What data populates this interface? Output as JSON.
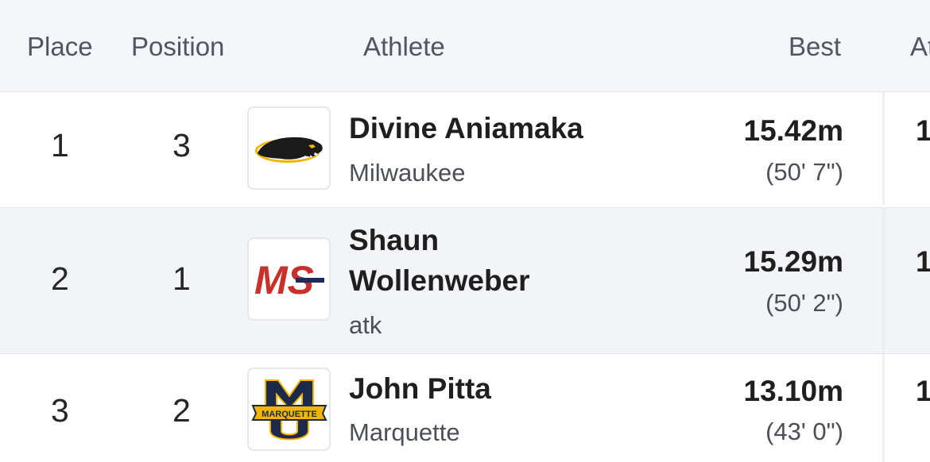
{
  "header": {
    "place": "Place",
    "position": "Position",
    "athlete": "Athlete",
    "best": "Best",
    "next_col": "At"
  },
  "rows": [
    {
      "place": "1",
      "position": "3",
      "name": "Divine Aniamaka",
      "team": "Milwaukee",
      "logo_icon": "panther-logo-icon",
      "best": "15.42m",
      "best_imperial": "(50' 7\")",
      "next_col": "1"
    },
    {
      "place": "2",
      "position": "1",
      "name_line1": "Shaun",
      "name_line2": "Wollenweber",
      "team": "atk",
      "logo_icon": "ms-logo-icon",
      "logo_text": "MS",
      "best": "15.29m",
      "best_imperial": "(50' 2\")",
      "next_col": "1"
    },
    {
      "place": "3",
      "position": "2",
      "name": "John Pitta",
      "team": "Marquette",
      "logo_icon": "marquette-logo-icon",
      "logo_text": "MARQUETTE",
      "best": "13.10m",
      "best_imperial": "(43' 0\")",
      "next_col": "1"
    }
  ],
  "colors": {
    "header_bg": "#f5f6fa",
    "alt_row_bg": "#f3f4f8",
    "ms_red": "#c8312a",
    "ms_navy": "#1f2a5c",
    "marquette_gold": "#f2b600",
    "marquette_navy": "#1b2a4a",
    "panther_gold": "#f0b400"
  }
}
